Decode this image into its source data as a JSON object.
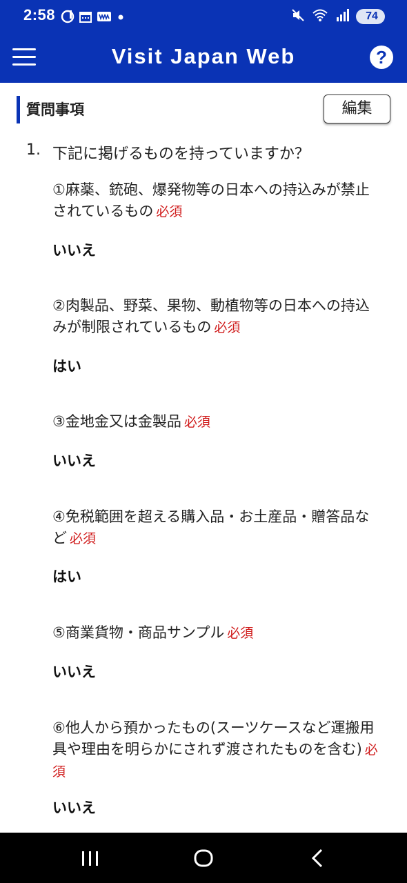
{
  "status_bar": {
    "time": "2:58",
    "battery": "74"
  },
  "header": {
    "title": "Visit Japan Web",
    "help_label": "?"
  },
  "section": {
    "title": "質問事項",
    "edit_label": "編集"
  },
  "question": {
    "number": "1.",
    "text": "下記に掲げるものを持っていますか？",
    "required_label": "必須",
    "items": [
      {
        "text": "①麻薬、銃砲、爆発物等の日本への持込みが禁止されているもの",
        "answer": "いいえ"
      },
      {
        "text": "②肉製品、野菜、果物、動植物等の日本への持込みが制限されているもの",
        "answer": "はい"
      },
      {
        "text": "③金地金又は金製品",
        "answer": "いいえ"
      },
      {
        "text": "④免税範囲を超える購入品・お土産品・贈答品など",
        "answer": "はい"
      },
      {
        "text": "⑤商業貨物・商品サンプル",
        "answer": "いいえ"
      },
      {
        "text": "⑥他人から預かったもの(スーツケースなど運搬用具や理由を明らかにされず渡されたものを含む)",
        "answer": "いいえ"
      }
    ]
  },
  "icons": {
    "status_left": [
      "d-payment-icon",
      "calendar-icon",
      "ww-app-icon",
      "notification-dot-icon"
    ],
    "status_right": [
      "mute-icon",
      "wifi-icon",
      "signal-icon",
      "battery-icon"
    ],
    "nav": [
      "recent-apps-icon",
      "home-icon",
      "back-icon"
    ]
  },
  "colors": {
    "brand": "#0a33b5",
    "required": "#d01c1c",
    "nav_bar": "#000000"
  }
}
